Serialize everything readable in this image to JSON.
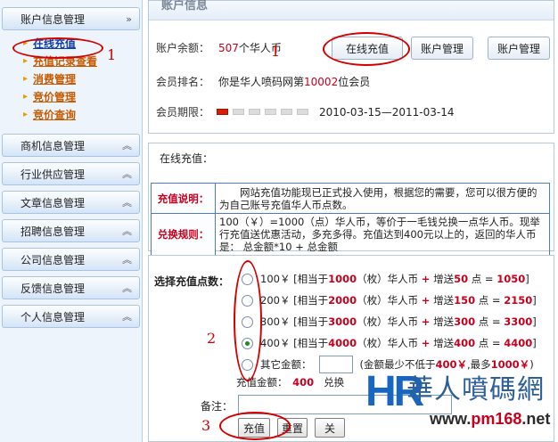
{
  "sidebar": {
    "account_header": "账户信息管理",
    "account_items": [
      "在线充值",
      "充值记录查看",
      "消费管理",
      "竞价管理",
      "竞价查询"
    ],
    "sections": [
      "商机信息管理",
      "行业供应管理",
      "文章信息管理",
      "招聘信息管理",
      "公司信息管理",
      "反馈信息管理",
      "个人信息管理"
    ]
  },
  "top_panel": {
    "title": "账户信息",
    "balance_label": "账户余额：",
    "balance_value": "507",
    "balance_unit": "个华人币",
    "rank_label": "会员排名：",
    "rank_prefix": "你是华人喷码网第",
    "rank_value": "10002",
    "rank_suffix": "位会员",
    "period_label": "会员期限：",
    "period_value": "2010-03-15—2011-03-14",
    "buttons": [
      "在线充值",
      "账户管理",
      "账户管理"
    ],
    "level_filled": 1,
    "level_total": 6
  },
  "mid_panel": {
    "section_title": "在线充值：",
    "note_label": "充值说明：",
    "note_text": "网站充值功能现已正式投入使用，根据您的需要，您可以很方便的为自己账号充值华人币点数。",
    "rule_label": "兑换规则：",
    "rule_text": "100（￥）=1000（点）华人币，等价于一毛钱兑换一点华人币。现举行充值送优惠活动，多充多得。充值达到400元以上的，返回的华人币是： 总金额*10 + 总金额"
  },
  "bottom_panel": {
    "pick_label": "选择充值点数：",
    "options": [
      {
        "amount": "100￥",
        "coins": "1000",
        "bonus": "50",
        "total": "1050"
      },
      {
        "amount": "200￥",
        "coins": "2000",
        "bonus": "150",
        "total": "2150"
      },
      {
        "amount": "300￥",
        "coins": "3000",
        "bonus": "300",
        "total": "3300"
      },
      {
        "amount": "400￥",
        "coins": "4000",
        "bonus": "400",
        "total": "4400"
      }
    ],
    "text_equal": "[相当于",
    "text_unit": "（枚）华人币",
    "text_gift": "增送",
    "text_points": "点 =",
    "other_label": "其它金额：",
    "other_hint_prefix": "(金额最少不低于",
    "other_min": "400￥",
    "other_hint_mid": ",最多",
    "other_max": "1000￥",
    "other_hint_suffix": ")",
    "total_label": "充值金额：",
    "total_value": "400",
    "total_suffix": "兑换",
    "note_label": "备注：",
    "buttons": [
      "充值",
      "重置",
      "关"
    ]
  },
  "annotations": [
    "1",
    "1",
    "2",
    "3"
  ],
  "watermark": {
    "logo": "HR",
    "name": "華人噴碼網",
    "url_prefix": "www.",
    "url_domain": "pm168",
    "url_suffix": ".net"
  }
}
